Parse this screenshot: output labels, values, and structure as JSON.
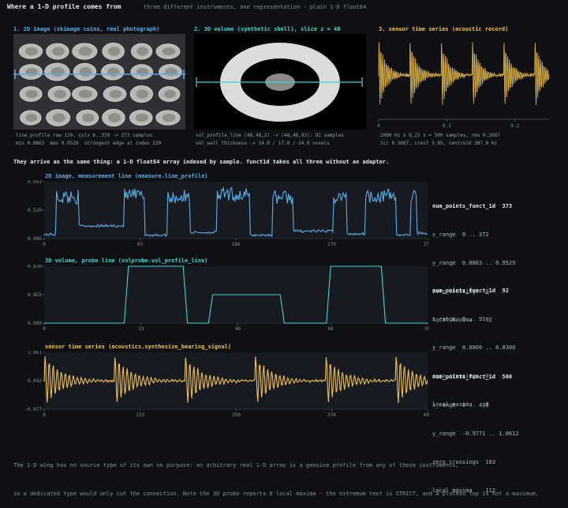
{
  "header": {
    "title": "Where a 1-D profile comes from",
    "subtitle": "three different instruments, one representation - plain 1-D float64"
  },
  "top_panels": [
    {
      "title": "1. 2D image (skimage coins, real photograph)",
      "caption_1": "line_profile row 120, cols 6..378 -> 373 samples",
      "caption_2": "min 0.0863  max 0.9529  strongest edge at index 220"
    },
    {
      "title": "2. 3D volume (synthetic shell), slice z = 48",
      "caption_1": "vol_profile_line (48,48,2) -> (48,48,93): 92 samples",
      "caption_2": "vol_wall_thickness -> 14.0 / 17.0 / 14.0 voxels"
    },
    {
      "title": "3. sensor time series (acoustic record)",
      "caption_1": "2000 Hz x 0.25 s = 500 samples, rms 0.2687",
      "caption_2": "icr 0.3667, crest 3.95, centroid 387.0 Hz",
      "x_ticks": [
        "0",
        "0.1",
        "0.2"
      ]
    }
  ],
  "intro": "They arrive as the same thing: a 1-D float64 array indexed by sample. funct1d takes all three without an adapter.",
  "colors": {
    "image": "#5aaee8",
    "volume": "#3fd6cf",
    "sensor": "#f1c24b",
    "bg": "#0e1014",
    "panel": "#111317"
  },
  "chart_data": [
    {
      "type": "line",
      "label": "2D image, measurement line   (measure.line_profile)",
      "x_ticks": [
        "0",
        "93",
        "186",
        "279",
        "372"
      ],
      "y_ticks": [
        "0.953",
        "0.520",
        "0.086"
      ],
      "xlim": [
        0,
        372
      ],
      "ylim": [
        0.0863,
        0.9529
      ],
      "stats": {
        "heading": "num_points_funct_1d  373",
        "x_range": "x_range  0 .. 372",
        "y_range": "y_range  0.0863 .. 0.9529",
        "zero_crossings": "zero_crossings  0",
        "local_maxima": "local maxima    92"
      }
    },
    {
      "type": "line",
      "label": "3D volume, probe line   (volprobe.vol_profile_line)",
      "x_ticks": [
        "0",
        "23",
        "46",
        "68",
        "91"
      ],
      "y_ticks": [
        "0.830",
        "0.455",
        "0.080"
      ],
      "xlim": [
        0,
        91
      ],
      "ylim": [
        0.08,
        0.83
      ],
      "segments": [
        [
          0,
          0.08
        ],
        [
          19,
          0.08
        ],
        [
          20,
          0.83
        ],
        [
          33,
          0.83
        ],
        [
          34,
          0.08
        ],
        [
          39,
          0.08
        ],
        [
          40,
          0.455
        ],
        [
          56,
          0.455
        ],
        [
          57,
          0.08
        ],
        [
          67,
          0.08
        ],
        [
          68,
          0.83
        ],
        [
          80,
          0.83
        ],
        [
          81,
          0.08
        ],
        [
          91,
          0.08
        ]
      ],
      "stats": {
        "heading": "num_points_funct_1d  92",
        "x_range": "x_range  0 .. 91",
        "y_range": "y_range  0.0800 .. 0.8300",
        "zero_crossings": "zero_crossings  0",
        "local_maxima": "local maxima    0"
      }
    },
    {
      "type": "line",
      "label": "sensor time series   (acoustics.synthesize_bearing_signal)",
      "x_ticks": [
        "0",
        "125",
        "250",
        "374",
        "499"
      ],
      "y_ticks": [
        "1.061",
        "0.042",
        "-0.977"
      ],
      "xlim": [
        0,
        499
      ],
      "ylim": [
        -0.9771,
        1.0612
      ],
      "impacts": [
        0,
        91,
        183,
        274,
        366,
        457
      ],
      "stats": {
        "heading": "num_points_funct_1d  500",
        "x_range": "x_range  0 .. 499",
        "y_range": "y_range  -0.9771 .. 1.0612",
        "zero_crossings": "zero_crossings  183",
        "local_maxima": "local maxima    112"
      }
    }
  ],
  "footer": {
    "line_1": "The 1-D wing has no source type of its own on purpose: an arbitrary real 1-D array is a genuine profile from any of these instruments,",
    "line_2": "so a dedicated type would only cut the connection. Note the 3D probe reports 0 local maxima - the extremum test is STRICT, and a plateau top is not a maximum."
  }
}
